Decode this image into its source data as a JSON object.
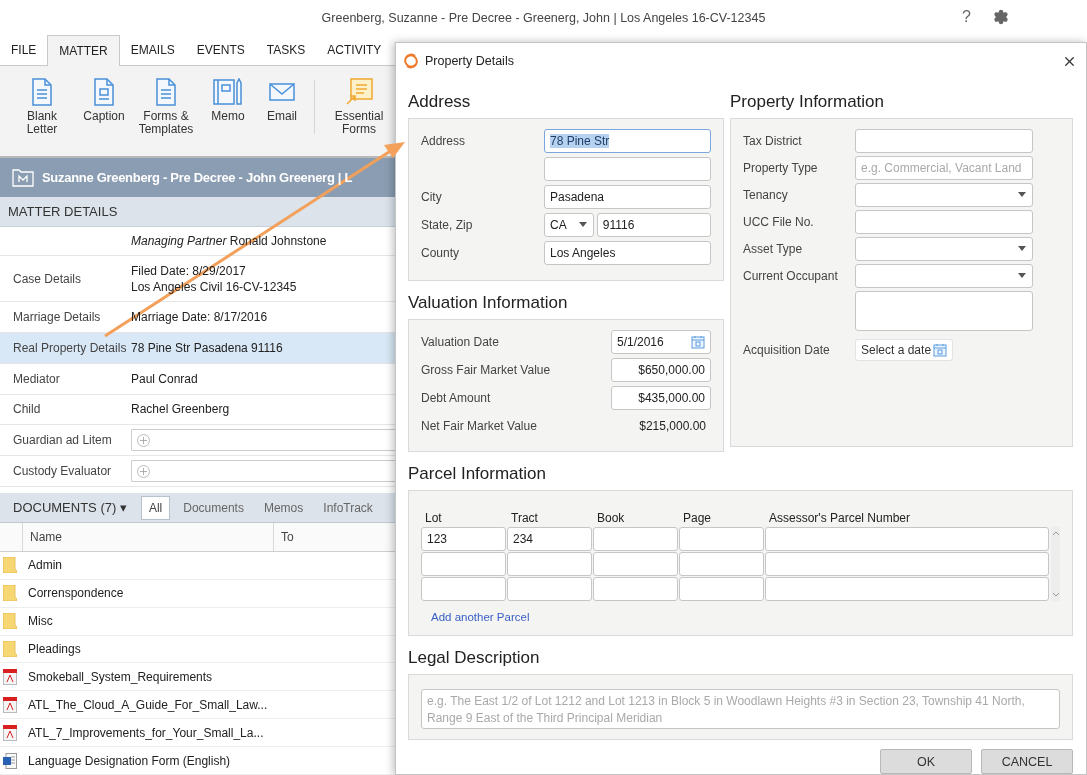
{
  "window": {
    "title": "Greenberg, Suzanne - Pre Decree - Greenerg, John | Los Angeles 16-CV-12345",
    "help": "?"
  },
  "ribbon_tabs": [
    {
      "label": "FILE",
      "selected": false
    },
    {
      "label": "MATTER",
      "selected": true
    },
    {
      "label": "EMAILS",
      "selected": false
    },
    {
      "label": "EVENTS",
      "selected": false
    },
    {
      "label": "TASKS",
      "selected": false
    },
    {
      "label": "ACTIVITY",
      "selected": false
    }
  ],
  "ribbon_buttons": [
    {
      "kind": "letter",
      "label": "Blank Letter"
    },
    {
      "kind": "caption",
      "label": "Caption"
    },
    {
      "kind": "letter",
      "label": "Forms & Templates"
    },
    {
      "kind": "memo",
      "label": "Memo"
    },
    {
      "kind": "email",
      "label": "Email"
    },
    {
      "kind": "essential",
      "label": "Essential Forms",
      "divider_before": true
    }
  ],
  "matter_header": {
    "title": "Suzanne Greenberg - Pre Decree - John Greenerg | L"
  },
  "matter_details": {
    "heading": "MATTER DETAILS",
    "rows": [
      {
        "kind": "text",
        "lines": [
          "*Managing Partner* Ronald Johnstone"
        ],
        "selected": false
      },
      {
        "kind": "text",
        "label": "Case Details",
        "lines": [
          "Filed Date: 8/29/2017",
          "Los Angeles Civil 16-CV-12345"
        ],
        "selected": false
      },
      {
        "kind": "text",
        "label": "Marriage Details",
        "lines": [
          "Marriage Date: 8/17/2016"
        ],
        "selected": false
      },
      {
        "kind": "text",
        "label": "Real Property Details",
        "lines": [
          "78 Pine Str Pasadena 91116"
        ],
        "selected": true
      },
      {
        "kind": "text",
        "label": "Mediator",
        "lines": [
          "Paul Conrad"
        ],
        "selected": false
      },
      {
        "kind": "text",
        "label": "Child",
        "lines": [
          "Rachel Greenberg"
        ],
        "selected": false
      },
      {
        "kind": "add",
        "label": "Guardian ad Litem",
        "selected": false
      },
      {
        "kind": "add",
        "label": "Custody Evaluator",
        "selected": false
      }
    ]
  },
  "documents": {
    "heading": "DOCUMENTS (7)",
    "dropdown_mark": "▾",
    "filters": [
      {
        "label": "All",
        "selected": true
      },
      {
        "label": "Documents",
        "selected": false
      },
      {
        "label": "Memos",
        "selected": false
      },
      {
        "label": "InfoTrack",
        "selected": false
      }
    ],
    "columns": [
      "Name",
      "To"
    ],
    "rows": [
      {
        "kind": "folder",
        "name": "Admin"
      },
      {
        "kind": "folder",
        "name": "Correnspondence"
      },
      {
        "kind": "folder",
        "name": "Misc"
      },
      {
        "kind": "folder",
        "name": "Pleadings"
      },
      {
        "kind": "pdf",
        "name": "Smokeball_System_Requirements"
      },
      {
        "kind": "pdf",
        "name": "ATL_The_Cloud_A_Guide_For_Small_Law..."
      },
      {
        "kind": "pdf",
        "name": "ATL_7_Improvements_for_Your_Small_La..."
      },
      {
        "kind": "word",
        "name": "Language Designation Form (English)"
      }
    ]
  },
  "dialog": {
    "title": "Property Details",
    "address": {
      "heading": "Address",
      "fields": [
        {
          "kind": "text",
          "label": "Address",
          "value": "78 Pine Str",
          "highlighted": true
        },
        {
          "kind": "text",
          "highlighted": false
        },
        {
          "kind": "text",
          "label": "City",
          "value": "Pasadena",
          "highlighted": false
        },
        {
          "kind": "state-zip",
          "label": "State, Zip",
          "state": "CA",
          "zip": "91116"
        },
        {
          "kind": "text",
          "label": "County",
          "value": "Los Angeles",
          "highlighted": false
        }
      ]
    },
    "valuation": {
      "heading": "Valuation Information",
      "fields": [
        {
          "kind": "date",
          "label": "Valuation Date",
          "value": "5/1/2016"
        },
        {
          "kind": "money",
          "label": "Gross Fair Market Value",
          "value": "$650,000.00"
        },
        {
          "kind": "money",
          "label": "Debt Amount",
          "value": "$435,000.00"
        },
        {
          "kind": "readout",
          "label": "Net Fair Market Value",
          "value": "$215,000.00"
        }
      ]
    },
    "property": {
      "heading": "Property Information",
      "fields": [
        {
          "kind": "text",
          "label": "Tax District"
        },
        {
          "kind": "text",
          "label": "Property Type",
          "placeholder": "e.g. Commercial, Vacant Land"
        },
        {
          "kind": "select",
          "label": "Tenancy"
        },
        {
          "kind": "text",
          "label": "UCC File No."
        },
        {
          "kind": "select",
          "label": "Asset Type"
        },
        {
          "kind": "select",
          "label": "Current Occupant"
        },
        {
          "kind": "textarea"
        },
        {
          "kind": "date",
          "label": "Acquisition Date",
          "placeholder": "Select a date"
        }
      ]
    },
    "parcel": {
      "heading": "Parcel Information",
      "columns": [
        "Lot",
        "Tract",
        "Book",
        "Page",
        "Assessor's Parcel Number"
      ],
      "rows": [
        {
          "kind": "filled",
          "cells": [
            "123",
            "234"
          ]
        },
        {
          "kind": "blank"
        },
        {
          "kind": "blank"
        }
      ],
      "link": "Add another Parcel"
    },
    "legal": {
      "heading": "Legal Description",
      "placeholder": "e.g. The East 1/2 of Lot 1212 and Lot 1213 in Block 5 in Woodlawn Heights #3 in Section 23, Township 41 North, Range 9 East of the Third Principal Meridian"
    },
    "buttons": [
      {
        "label": "OK"
      },
      {
        "label": "CANCEL"
      }
    ]
  }
}
